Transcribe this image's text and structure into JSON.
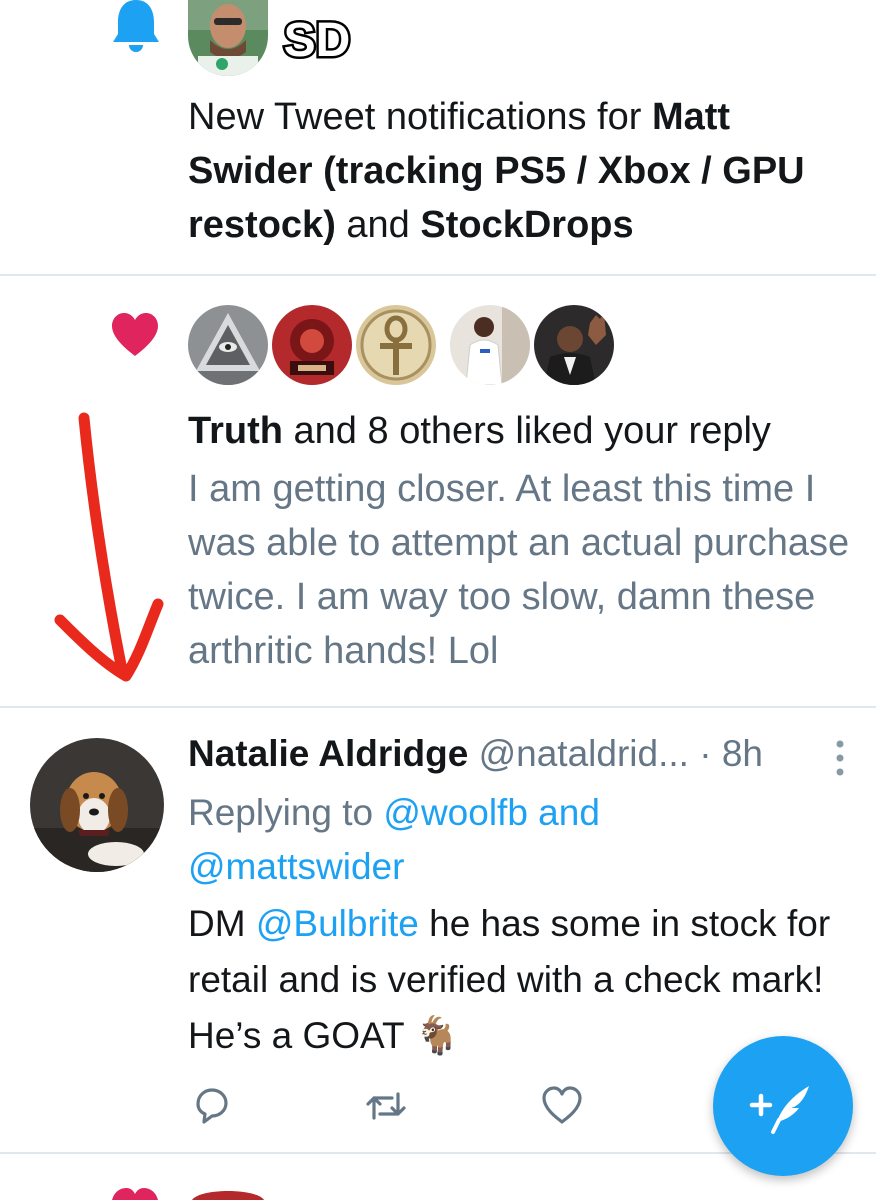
{
  "notifications": [
    {
      "type": "new-tweet",
      "icon": "bell-icon",
      "badge_text": "SD",
      "text_prefix": "New Tweet notifications for ",
      "user1": "Matt Swider (tracking PS5 / Xbox / GPU restock)",
      "text_mid": " and ",
      "user2": "StockDrops"
    },
    {
      "type": "like",
      "icon": "heart-icon",
      "liker": "Truth",
      "text_rest": " and 8 others liked your reply",
      "reply_text": "I am getting closer. At least this time I was able to attempt an actual purchase twice. I am way too slow, damn these arthritic hands! Lol"
    }
  ],
  "tweet": {
    "name": "Natalie Aldridge",
    "handle": "@nataldrid...",
    "time": "· 8h",
    "replying_prefix": "Replying to ",
    "reply_user1": "@woolfb",
    "replying_and": " and",
    "reply_user2": "@mattswider",
    "body_before": "DM ",
    "body_mention": "@Bulbrite",
    "body_after": " he has some in stock for retail and is verified with a check mark! He’s a GOAT ",
    "body_emoji": "🐐",
    "actions": [
      "reply-icon",
      "retweet-icon",
      "like-icon"
    ]
  },
  "annotation": {
    "color": "#e8291c",
    "type": "hand-drawn-arrow-down"
  },
  "colors": {
    "accent": "#1da1f2",
    "heart": "#e0245e",
    "muted": "#657786",
    "divider": "#e1e8ed"
  },
  "fab": {
    "icon": "compose-tweet-icon"
  }
}
